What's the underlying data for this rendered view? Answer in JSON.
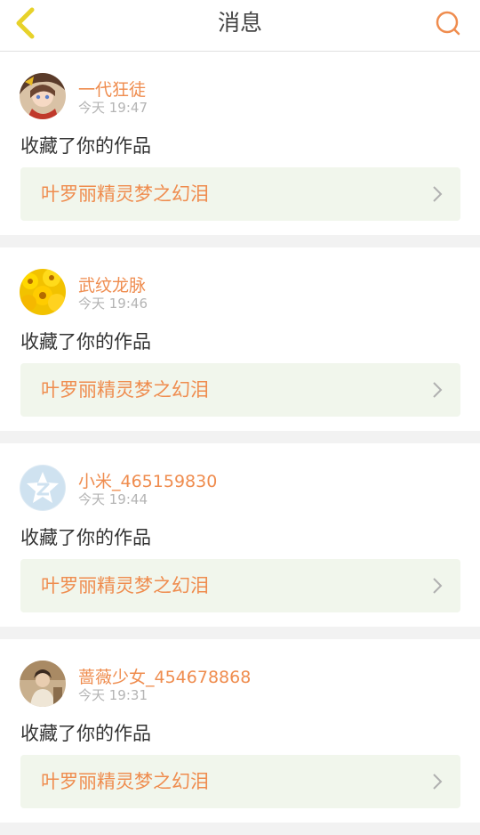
{
  "header": {
    "title": "消息",
    "back_icon": "chevron-left-icon",
    "search_icon": "search-icon"
  },
  "colors": {
    "accent": "#ef8c4e",
    "back_icon": "#e7d22a",
    "work_box_bg": "#f1f6ec"
  },
  "messages": [
    {
      "username": "一代狂徒",
      "time": "今天 19:47",
      "action": "收藏了你的作品",
      "work_title": "叶罗丽精灵梦之幻泪",
      "avatar": "anime-girl-avatar"
    },
    {
      "username": "武纹龙脉",
      "time": "今天 19:46",
      "action": "收藏了你的作品",
      "work_title": "叶罗丽精灵梦之幻泪",
      "avatar": "sunflower-avatar"
    },
    {
      "username": "小米_465159830",
      "time": "今天 19:44",
      "action": "收藏了你的作品",
      "work_title": "叶罗丽精灵梦之幻泪",
      "avatar": "default-star-avatar"
    },
    {
      "username": "蔷薇少女_454678868",
      "time": "今天 19:31",
      "action": "收藏了你的作品",
      "work_title": "叶罗丽精灵梦之幻泪",
      "avatar": "photo-avatar"
    }
  ]
}
